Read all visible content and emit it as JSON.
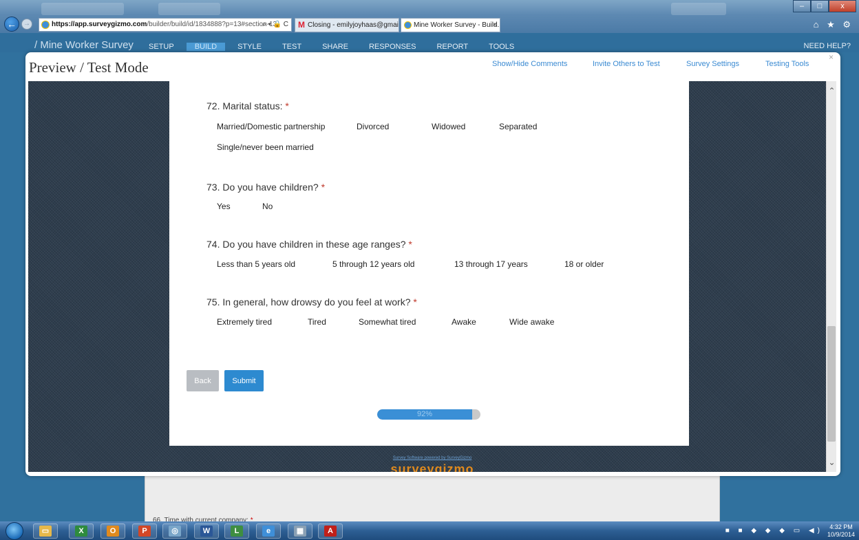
{
  "browser": {
    "url_domain": "https://app.surveygizmo.com",
    "url_path": "/builder/build/id/1834888?p=13#section-13",
    "address_controls": "⌕ ▾ 🔒 C",
    "tabs": [
      {
        "label": "Closing - emilyjoyhaas@gmail..."
      },
      {
        "label": "Mine Worker Survey - Build...",
        "close": "×"
      }
    ],
    "window_controls": [
      "–",
      "□",
      "x"
    ],
    "toolbar_icons": "⌂ ★ ⚙"
  },
  "app": {
    "title": "/ Mine Worker Survey",
    "nav": [
      "SETUP",
      "BUILD",
      "STYLE",
      "TEST",
      "SHARE",
      "RESPONSES",
      "REPORT",
      "TOOLS"
    ],
    "need_help": "NEED HELP?",
    "behind_text": "66. Time with current company:",
    "behind_required": "*"
  },
  "modal": {
    "title": "Preview / Test Mode",
    "close": "×",
    "links": [
      "Show/Hide Comments",
      "Invite Others to Test",
      "Survey Settings",
      "Testing Tools"
    ]
  },
  "survey": {
    "questions": [
      {
        "title": "72. Marital status:",
        "required": "*",
        "options": [
          "Married/Domestic partnership",
          "Divorced",
          "Widowed",
          "Separated",
          "Single/never been married"
        ]
      },
      {
        "title": "73. Do you have children?",
        "required": "*",
        "options": [
          "Yes",
          "No"
        ]
      },
      {
        "title": "74. Do you have children in these age ranges?",
        "required": "*",
        "options": [
          "Less than 5 years old",
          "5 through 12 years old",
          "13 through 17 years",
          "18 or older"
        ]
      },
      {
        "title": "75. In general, how drowsy do you feel at work?",
        "required": "*",
        "options": [
          "Extremely tired",
          "Tired",
          "Somewhat tired",
          "Awake",
          "Wide awake"
        ]
      }
    ],
    "back_label": "Back",
    "submit_label": "Submit",
    "progress_percent": 92,
    "progress_label": "92%",
    "powered_by": "Survey Software powered by SurveyGizmo",
    "brand": "surveygizmo"
  },
  "taskbar": {
    "apps": [
      {
        "name": "explorer",
        "glyph": "▭",
        "color": "#e6b84a"
      },
      {
        "name": "excel",
        "glyph": "X",
        "color": "#2e8b3e"
      },
      {
        "name": "outlook",
        "glyph": "O",
        "color": "#e08a1e"
      },
      {
        "name": "powerpoint",
        "glyph": "P",
        "color": "#d24726"
      },
      {
        "name": "browser",
        "glyph": "◎",
        "color": "#7aa6c9"
      },
      {
        "name": "word",
        "glyph": "W",
        "color": "#2b5797"
      },
      {
        "name": "project",
        "glyph": "L",
        "color": "#3e8e41"
      },
      {
        "name": "internet-explorer",
        "glyph": "e",
        "color": "#3f8fd8"
      },
      {
        "name": "calculator",
        "glyph": "▦",
        "color": "#8aa0b4"
      },
      {
        "name": "acrobat",
        "glyph": "A",
        "color": "#c0201a"
      }
    ],
    "tray_icons": "■ ■ ◆ ◆ ◆ ▭ ◀)",
    "time": "4:32 PM",
    "date": "10/9/2014"
  }
}
